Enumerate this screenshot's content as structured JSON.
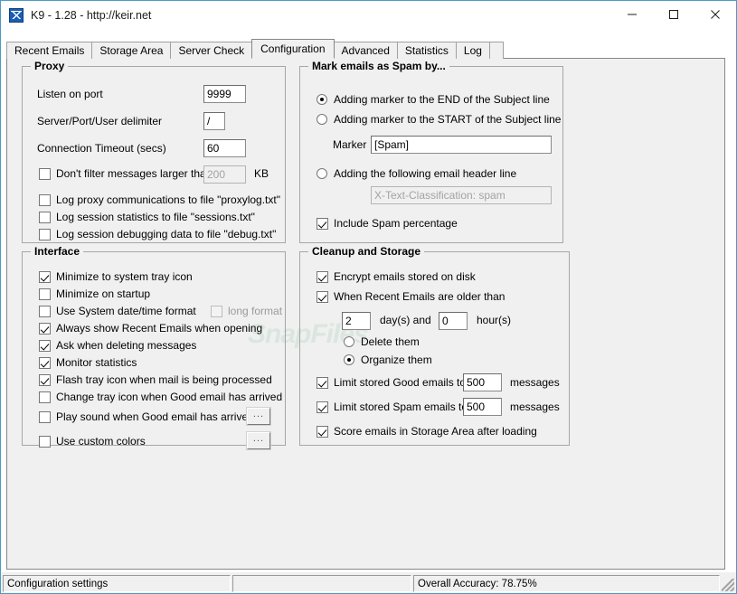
{
  "window": {
    "title": "K9 - 1.28 - http://keir.net",
    "icon": "k9-app-icon",
    "minimize": "─",
    "maximize": "□",
    "close": "✕"
  },
  "tabs": [
    {
      "label": "Recent Emails",
      "active": false
    },
    {
      "label": "Storage Area",
      "active": false
    },
    {
      "label": "Server Check",
      "active": false
    },
    {
      "label": "Configuration",
      "active": true
    },
    {
      "label": "Advanced",
      "active": false
    },
    {
      "label": "Statistics",
      "active": false
    },
    {
      "label": "Log",
      "active": false
    }
  ],
  "proxy": {
    "legend": "Proxy",
    "listen_port_label": "Listen on port",
    "listen_port_value": "9999",
    "delimiter_label": "Server/Port/User delimiter",
    "delimiter_value": "/",
    "timeout_label": "Connection Timeout (secs)",
    "timeout_value": "60",
    "size_filter_label": "Don't filter messages larger than",
    "size_filter_checked": false,
    "size_filter_value": "200",
    "size_filter_unit": "KB",
    "log_proxy_label": "Log proxy communications to file \"proxylog.txt\"",
    "log_proxy_checked": false,
    "log_stats_label": "Log session statistics to file \"sessions.txt\"",
    "log_stats_checked": false,
    "log_debug_label": "Log session debugging data to file \"debug.txt\"",
    "log_debug_checked": false
  },
  "interface": {
    "legend": "Interface",
    "items": [
      {
        "label": "Minimize to system tray icon",
        "checked": true
      },
      {
        "label": "Minimize on startup",
        "checked": false
      },
      {
        "label": "Use System date/time format",
        "checked": false
      },
      {
        "label": "Always show Recent Emails when opening",
        "checked": true
      },
      {
        "label": "Ask when deleting messages",
        "checked": true
      },
      {
        "label": "Monitor statistics",
        "checked": true
      },
      {
        "label": "Flash tray icon when mail is being processed",
        "checked": true
      },
      {
        "label": "Change tray icon when Good email has arrived",
        "checked": false
      },
      {
        "label": "Play sound when Good email has arrived",
        "checked": false
      },
      {
        "label": "Use custom colors",
        "checked": false
      }
    ],
    "long_format_label": "long format",
    "long_format_checked": false,
    "browse_sound_label": "...",
    "browse_colors_label": "..."
  },
  "spam_marking": {
    "legend": "Mark emails as Spam by...",
    "option_end_label": "Adding marker to the END of the Subject line",
    "option_start_label": "Adding marker to the START of the Subject line",
    "option_header_label": "Adding the following email header line",
    "selected_option": "end",
    "marker_label": "Marker",
    "marker_value": "[Spam]",
    "header_value": "X-Text-Classification: spam",
    "include_percentage_label": "Include Spam percentage",
    "include_percentage_checked": true
  },
  "cleanup": {
    "legend": "Cleanup and Storage",
    "encrypt_label": "Encrypt emails stored on disk",
    "encrypt_checked": true,
    "older_than_label": "When Recent Emails are older than",
    "older_than_checked": true,
    "days_value": "2",
    "days_unit": "day(s) and",
    "hours_value": "0",
    "hours_unit": "hour(s)",
    "delete_them_label": "Delete them",
    "organize_them_label": "Organize them",
    "age_action": "organize",
    "limit_good_label": "Limit stored Good emails to",
    "limit_good_checked": true,
    "limit_good_value": "500",
    "limit_good_unit": "messages",
    "limit_spam_label": "Limit stored Spam emails to",
    "limit_spam_checked": true,
    "limit_spam_value": "500",
    "limit_spam_unit": "messages",
    "score_label": "Score emails in Storage Area after loading",
    "score_checked": true
  },
  "statusbar": {
    "left": "Configuration settings",
    "middle": "",
    "right": "Overall Accuracy: 78.75%"
  },
  "watermark": "SnapFiles"
}
